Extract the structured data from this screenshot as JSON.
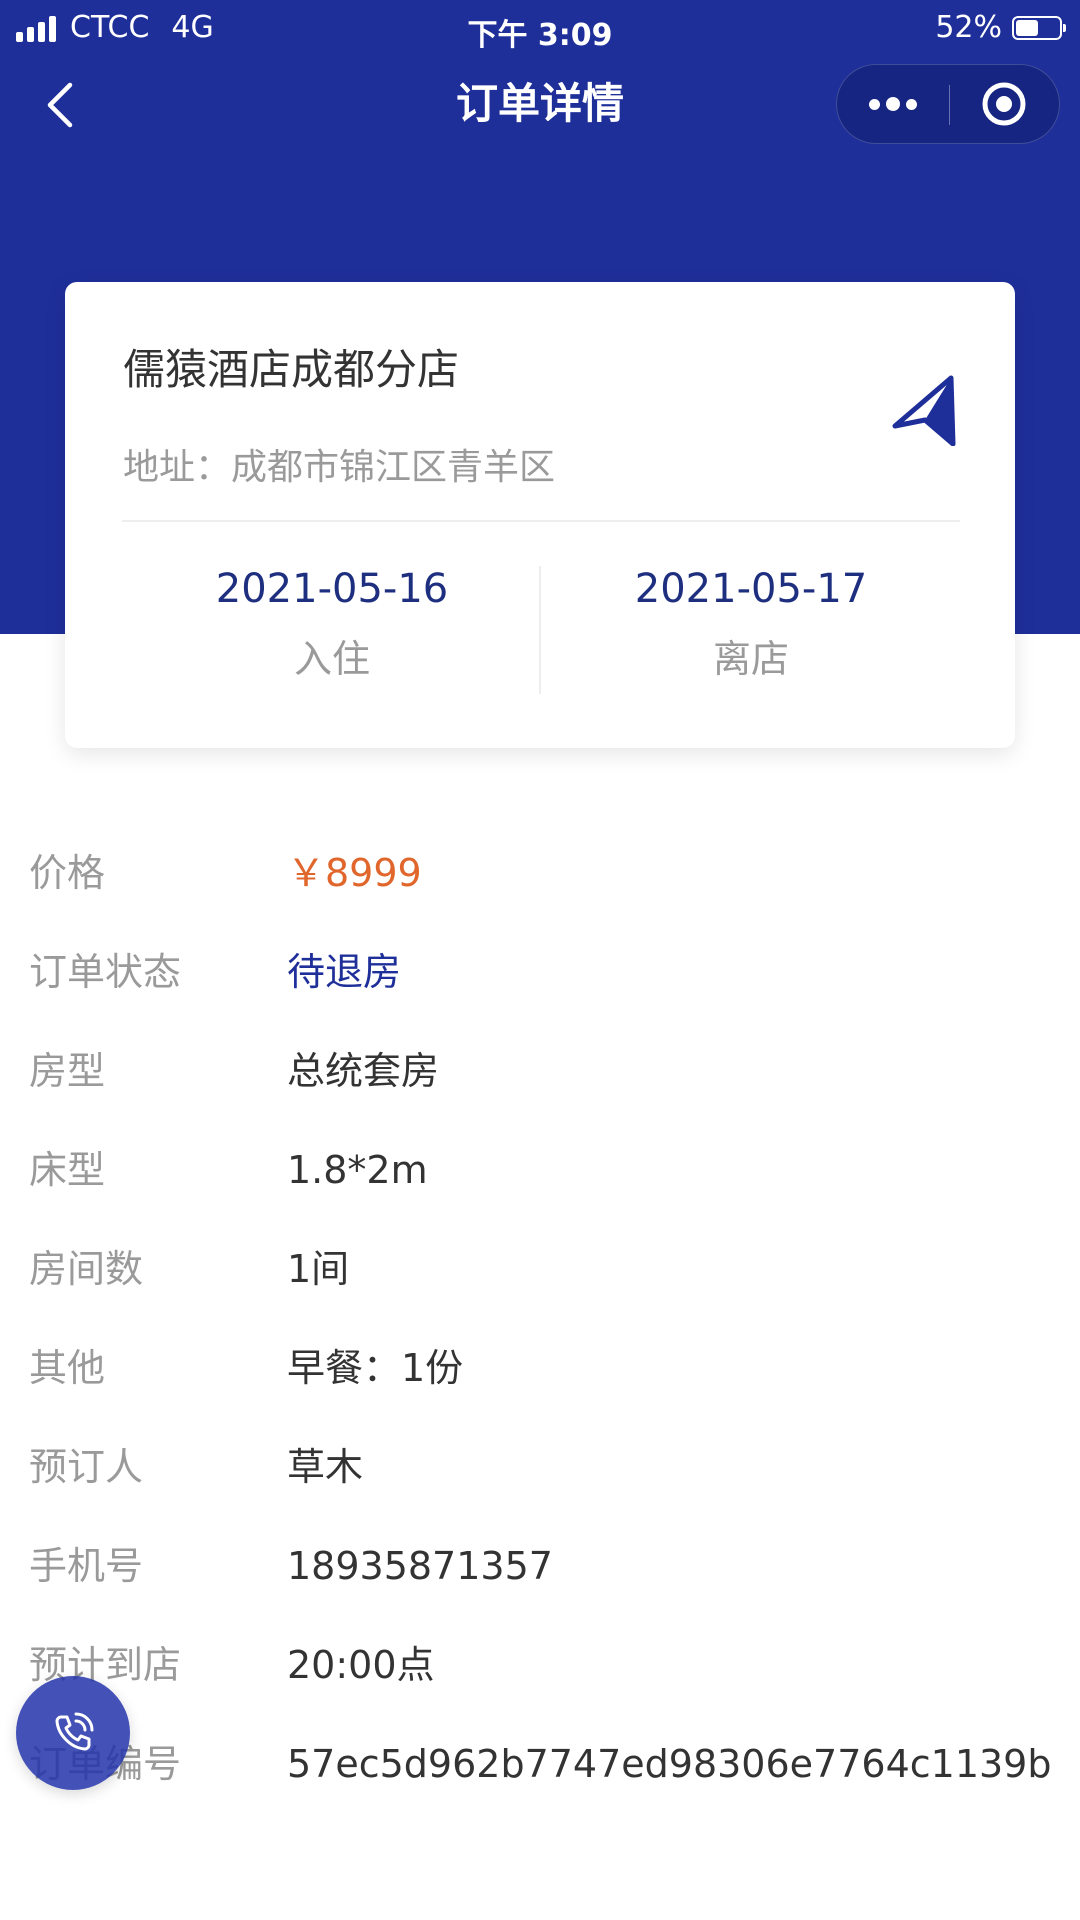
{
  "status_bar": {
    "carrier": "CTCC",
    "network": "4G",
    "time": "下午 3:09",
    "battery_percent": "52%",
    "battery_level": 0.52
  },
  "nav": {
    "title": "订单详情",
    "back_icon": "chevron-left-icon",
    "more_icon": "more-dots-icon",
    "close_icon": "target-circle-icon"
  },
  "hotel": {
    "name": "儒猿酒店成都分店",
    "address": "地址：成都市锦江区青羊区",
    "nav_icon": "navigation-arrow-icon",
    "check_in": {
      "date": "2021-05-16",
      "label": "入住"
    },
    "check_out": {
      "date": "2021-05-17",
      "label": "离店"
    }
  },
  "details": [
    {
      "label": "价格",
      "value": "￥8999"
    },
    {
      "label": "订单状态",
      "value": "待退房"
    },
    {
      "label": "房型",
      "value": "总统套房"
    },
    {
      "label": "床型",
      "value": "1.8*2m"
    },
    {
      "label": "房间数",
      "value": "1间"
    },
    {
      "label": "其他",
      "value": "早餐：1份"
    },
    {
      "label": "预订人",
      "value": "草木"
    },
    {
      "label": "手机号",
      "value": "18935871357"
    },
    {
      "label": "预计到店",
      "value": "20:00点"
    },
    {
      "label": "订单编号",
      "value": "57ec5d962b7747ed98306e7764c1139b"
    }
  ],
  "fab": {
    "icon": "phone-call-icon"
  },
  "colors": {
    "header": "#1f2f9a",
    "price": "#e0662c",
    "status": "#1f2f9a",
    "date": "#1f2f80",
    "label": "#9a9a9a"
  }
}
